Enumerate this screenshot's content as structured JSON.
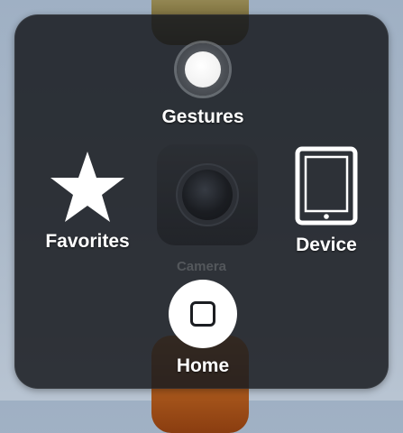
{
  "menu": {
    "gestures_label": "Gestures",
    "favorites_label": "Favorites",
    "device_label": "Device",
    "home_label": "Home"
  },
  "background": {
    "camera_label": "Camera"
  },
  "icons": {
    "gestures": "gesture-dot-icon",
    "favorites": "star-icon",
    "device": "ipad-icon",
    "home": "home-button-icon"
  }
}
